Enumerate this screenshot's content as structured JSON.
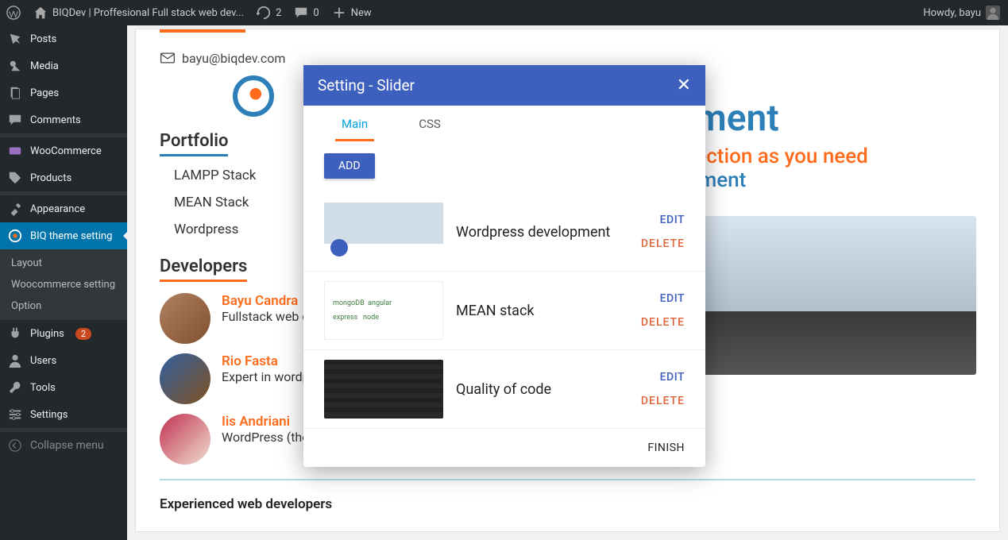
{
  "adminbar": {
    "site": "BIQDev | Proffesional Full stack web dev...",
    "updates": "2",
    "comments": "0",
    "new": "New",
    "howdy": "Howdy, bayu"
  },
  "menu": {
    "posts": "Posts",
    "media": "Media",
    "pages": "Pages",
    "comments": "Comments",
    "woocommerce": "WooCommerce",
    "products": "Products",
    "appearance": "Appearance",
    "biq": "BIQ theme setting",
    "sub": {
      "layout": "Layout",
      "woo": "Woocommerce setting",
      "option": "Option"
    },
    "plugins": "Plugins",
    "plugins_badge": "2",
    "users": "Users",
    "tools": "Tools",
    "settings": "Settings",
    "collapse": "Collapse menu"
  },
  "page": {
    "email": "bayu@biqdev.com",
    "portfolio_h": "Portfolio",
    "portfolio": [
      "LAMPP Stack",
      "MEAN Stack",
      "Wordpress"
    ],
    "developers_h": "Developers",
    "devs": [
      {
        "name": "Bayu Candra",
        "desc": "Fullstack web developer in ..."
      },
      {
        "name": "Rio Fasta",
        "desc": "Expert in wordpress development"
      },
      {
        "name": "Iis Andriani",
        "desc": "WordPress (theme) expert"
      }
    ],
    "hero_title": "Development",
    "hero_sub1": "Match for perfection as you need",
    "hero_sub2": "Faster development",
    "exp": "Experienced web developers"
  },
  "modal": {
    "title": "Setting - Slider",
    "tabs": {
      "main": "Main",
      "css": "CSS"
    },
    "add": "ADD",
    "edit": "EDIT",
    "delete": "DELETE",
    "finish": "FINISH",
    "rows": [
      {
        "title": "Wordpress development"
      },
      {
        "title": "MEAN stack"
      },
      {
        "title": "Quality of code"
      }
    ]
  }
}
